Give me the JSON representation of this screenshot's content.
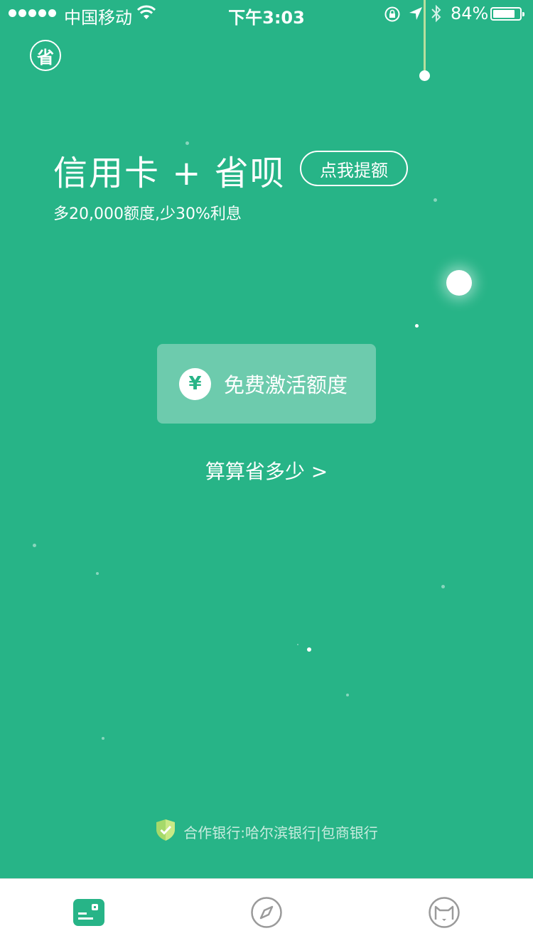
{
  "status_bar": {
    "carrier": "中国移动",
    "time": "下午3:03",
    "battery_text": "84%",
    "battery_level": 0.84,
    "signal_bars": 5
  },
  "header": {
    "logo_glyph": "省"
  },
  "promo": {
    "title": "信用卡 + 省呗",
    "raise_button": "点我提额",
    "subtitle": "多20,000额度,少30%利息"
  },
  "activate": {
    "icon_glyph": "¥",
    "label": "免费激活额度"
  },
  "calc_link": "算算省多少 >",
  "footer": {
    "banks_text": "合作银行:哈尔滨银行|包商银行"
  },
  "tabbar": {
    "items": [
      {
        "icon": "wallet-icon",
        "active": true
      },
      {
        "icon": "compass-icon",
        "active": false
      },
      {
        "icon": "cat-face-icon",
        "active": false
      }
    ]
  },
  "colors": {
    "brand_green": "#27b487",
    "activate_bg": "#6dcbad",
    "inactive_icon": "#9a9a9a"
  }
}
